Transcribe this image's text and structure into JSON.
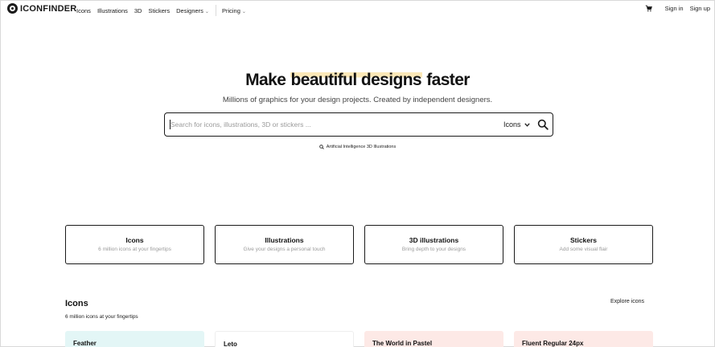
{
  "header": {
    "logo_text": "ICONFINDER",
    "nav": [
      {
        "label": "Icons"
      },
      {
        "label": "Illustrations"
      },
      {
        "label": "3D"
      },
      {
        "label": "Stickers"
      },
      {
        "label": "Designers",
        "has_dropdown": true
      },
      {
        "label": "Pricing",
        "has_dropdown": true
      }
    ],
    "cart_icon": "cart-icon",
    "sign_in": "Sign in",
    "sign_up": "Sign up"
  },
  "hero": {
    "title_before": "Make ",
    "title_highlight": "beautiful designs",
    "title_after": " faster",
    "highlight_color": "#fbe8b8",
    "subtitle": "Millions of graphics for your design projects. Created by independent designers."
  },
  "search": {
    "placeholder": "Search for icons, illustrations, 3D or stickers ...",
    "value": "",
    "type_selected": "Icons",
    "search_icon": "search-icon",
    "suggestion": "Artificial Intelligence 3D Illustrations"
  },
  "categories": [
    {
      "title": "Icons",
      "subtitle": "6 million icons at your fingertips"
    },
    {
      "title": "Illustrations",
      "subtitle": "Give your designs a personal touch"
    },
    {
      "title": "3D illustrations",
      "subtitle": "Bring depth to your designs"
    },
    {
      "title": "Stickers",
      "subtitle": "Add some visual flair"
    }
  ],
  "icons_section": {
    "title": "Icons",
    "subtitle": "6 million icons at your fingertips",
    "explore_label": "Explore icons",
    "sets": [
      {
        "title": "Feather",
        "bg": "#e3f6f6"
      },
      {
        "title": "Leto",
        "bg": "#ffffff"
      },
      {
        "title": "The World in Pastel",
        "bg": "#fde9e6"
      },
      {
        "title": "Fluent Regular 24px",
        "bg": "#fde9e6"
      }
    ]
  }
}
